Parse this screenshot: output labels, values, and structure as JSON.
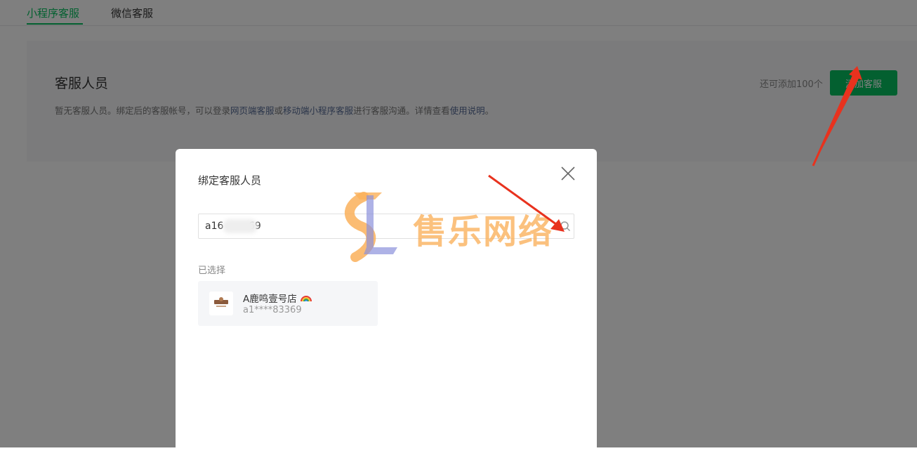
{
  "tabs": [
    {
      "label": "小程序客服",
      "active": true
    },
    {
      "label": "微信客服",
      "active": false
    }
  ],
  "panel": {
    "title": "客服人员",
    "desc_pre": "暂无客服人员。绑定后的客服帐号，可以登录",
    "desc_link1": "网页端客服",
    "desc_mid1": "或",
    "desc_link2": "移动端小程序客服",
    "desc_mid2": "进行客服沟通。详情查看",
    "desc_link3": "使用说明",
    "desc_post": "。",
    "remain": "还可添加100个",
    "add_button": "添加客服"
  },
  "dialog": {
    "title": "绑定客服人员",
    "search_value": "a16        69",
    "selected_label": "已选择",
    "selected": {
      "name": "A鹿鸣壹号店",
      "id": "a1****83369"
    }
  },
  "watermark": {
    "text": "售乐网络"
  },
  "colors": {
    "accent": "#07c160",
    "link": "#576b95",
    "arrow": "#e8321e",
    "watermark": "#fab05a"
  },
  "icons": [
    "close-icon",
    "search-icon",
    "rainbow-icon",
    "watermark-logo",
    "red-arrow"
  ]
}
